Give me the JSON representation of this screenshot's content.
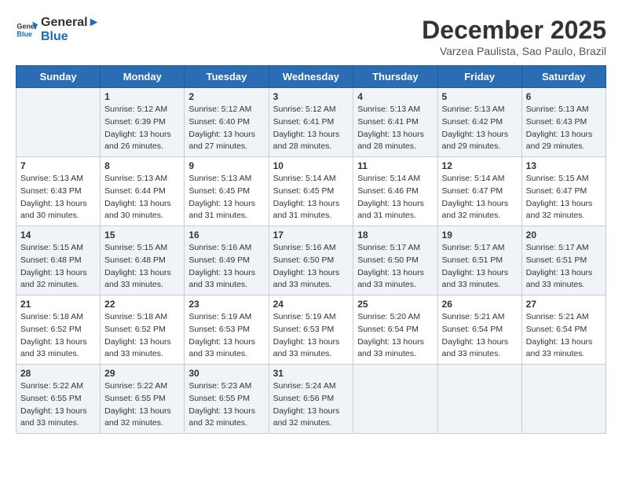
{
  "logo": {
    "line1": "General",
    "line2": "Blue"
  },
  "title": "December 2025",
  "location": "Varzea Paulista, Sao Paulo, Brazil",
  "days_of_week": [
    "Sunday",
    "Monday",
    "Tuesday",
    "Wednesday",
    "Thursday",
    "Friday",
    "Saturday"
  ],
  "weeks": [
    [
      {
        "num": "",
        "info": ""
      },
      {
        "num": "1",
        "info": "Sunrise: 5:12 AM\nSunset: 6:39 PM\nDaylight: 13 hours\nand 26 minutes."
      },
      {
        "num": "2",
        "info": "Sunrise: 5:12 AM\nSunset: 6:40 PM\nDaylight: 13 hours\nand 27 minutes."
      },
      {
        "num": "3",
        "info": "Sunrise: 5:12 AM\nSunset: 6:41 PM\nDaylight: 13 hours\nand 28 minutes."
      },
      {
        "num": "4",
        "info": "Sunrise: 5:13 AM\nSunset: 6:41 PM\nDaylight: 13 hours\nand 28 minutes."
      },
      {
        "num": "5",
        "info": "Sunrise: 5:13 AM\nSunset: 6:42 PM\nDaylight: 13 hours\nand 29 minutes."
      },
      {
        "num": "6",
        "info": "Sunrise: 5:13 AM\nSunset: 6:43 PM\nDaylight: 13 hours\nand 29 minutes."
      }
    ],
    [
      {
        "num": "7",
        "info": "Sunrise: 5:13 AM\nSunset: 6:43 PM\nDaylight: 13 hours\nand 30 minutes."
      },
      {
        "num": "8",
        "info": "Sunrise: 5:13 AM\nSunset: 6:44 PM\nDaylight: 13 hours\nand 30 minutes."
      },
      {
        "num": "9",
        "info": "Sunrise: 5:13 AM\nSunset: 6:45 PM\nDaylight: 13 hours\nand 31 minutes."
      },
      {
        "num": "10",
        "info": "Sunrise: 5:14 AM\nSunset: 6:45 PM\nDaylight: 13 hours\nand 31 minutes."
      },
      {
        "num": "11",
        "info": "Sunrise: 5:14 AM\nSunset: 6:46 PM\nDaylight: 13 hours\nand 31 minutes."
      },
      {
        "num": "12",
        "info": "Sunrise: 5:14 AM\nSunset: 6:47 PM\nDaylight: 13 hours\nand 32 minutes."
      },
      {
        "num": "13",
        "info": "Sunrise: 5:15 AM\nSunset: 6:47 PM\nDaylight: 13 hours\nand 32 minutes."
      }
    ],
    [
      {
        "num": "14",
        "info": "Sunrise: 5:15 AM\nSunset: 6:48 PM\nDaylight: 13 hours\nand 32 minutes."
      },
      {
        "num": "15",
        "info": "Sunrise: 5:15 AM\nSunset: 6:48 PM\nDaylight: 13 hours\nand 33 minutes."
      },
      {
        "num": "16",
        "info": "Sunrise: 5:16 AM\nSunset: 6:49 PM\nDaylight: 13 hours\nand 33 minutes."
      },
      {
        "num": "17",
        "info": "Sunrise: 5:16 AM\nSunset: 6:50 PM\nDaylight: 13 hours\nand 33 minutes."
      },
      {
        "num": "18",
        "info": "Sunrise: 5:17 AM\nSunset: 6:50 PM\nDaylight: 13 hours\nand 33 minutes."
      },
      {
        "num": "19",
        "info": "Sunrise: 5:17 AM\nSunset: 6:51 PM\nDaylight: 13 hours\nand 33 minutes."
      },
      {
        "num": "20",
        "info": "Sunrise: 5:17 AM\nSunset: 6:51 PM\nDaylight: 13 hours\nand 33 minutes."
      }
    ],
    [
      {
        "num": "21",
        "info": "Sunrise: 5:18 AM\nSunset: 6:52 PM\nDaylight: 13 hours\nand 33 minutes."
      },
      {
        "num": "22",
        "info": "Sunrise: 5:18 AM\nSunset: 6:52 PM\nDaylight: 13 hours\nand 33 minutes."
      },
      {
        "num": "23",
        "info": "Sunrise: 5:19 AM\nSunset: 6:53 PM\nDaylight: 13 hours\nand 33 minutes."
      },
      {
        "num": "24",
        "info": "Sunrise: 5:19 AM\nSunset: 6:53 PM\nDaylight: 13 hours\nand 33 minutes."
      },
      {
        "num": "25",
        "info": "Sunrise: 5:20 AM\nSunset: 6:54 PM\nDaylight: 13 hours\nand 33 minutes."
      },
      {
        "num": "26",
        "info": "Sunrise: 5:21 AM\nSunset: 6:54 PM\nDaylight: 13 hours\nand 33 minutes."
      },
      {
        "num": "27",
        "info": "Sunrise: 5:21 AM\nSunset: 6:54 PM\nDaylight: 13 hours\nand 33 minutes."
      }
    ],
    [
      {
        "num": "28",
        "info": "Sunrise: 5:22 AM\nSunset: 6:55 PM\nDaylight: 13 hours\nand 33 minutes."
      },
      {
        "num": "29",
        "info": "Sunrise: 5:22 AM\nSunset: 6:55 PM\nDaylight: 13 hours\nand 32 minutes."
      },
      {
        "num": "30",
        "info": "Sunrise: 5:23 AM\nSunset: 6:55 PM\nDaylight: 13 hours\nand 32 minutes."
      },
      {
        "num": "31",
        "info": "Sunrise: 5:24 AM\nSunset: 6:56 PM\nDaylight: 13 hours\nand 32 minutes."
      },
      {
        "num": "",
        "info": ""
      },
      {
        "num": "",
        "info": ""
      },
      {
        "num": "",
        "info": ""
      }
    ]
  ]
}
